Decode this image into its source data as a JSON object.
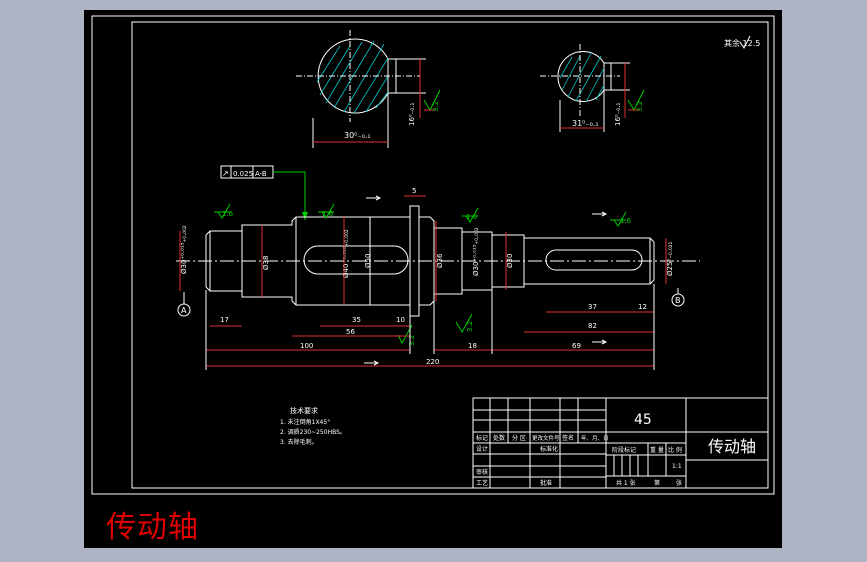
{
  "colors": {
    "background": "#aeb4c4",
    "sheet": "#000000",
    "lines": "#ffffff",
    "dimension": "#e03030",
    "leader": "#00cc00",
    "hatch": "#00c8c8",
    "title_red": "#e00000"
  },
  "page_title": "传动轴",
  "roughness_note": "其余 12.5",
  "sections": {
    "left": {
      "width_dim": "30⁰₋₀.₁",
      "depth_dim": "16⁰₋₀.₁",
      "finish": "3.2"
    },
    "right": {
      "width_dim": "31⁰₋₀.₁",
      "depth_dim": "16⁰₋₀.₁",
      "finish": "3.2"
    }
  },
  "tolerance_frame": {
    "symbol": "↗",
    "value": "0.025",
    "datum": "A-B"
  },
  "surface_finish": [
    "1.6",
    "1.6",
    "1.6",
    "1.6"
  ],
  "side_finish": [
    "3.2",
    "3.2"
  ],
  "datums": [
    "A",
    "B"
  ],
  "diameters": [
    "Ø30⁺⁰·⁰¹⁵₊₀.₀₀₂",
    "Ø38",
    "Ø40⁺⁰·⁰¹⁸₊₀.₀₀₂",
    "Ø50",
    "Ø36",
    "Ø30⁺⁰·⁰¹⁵₊₀.₀₀₂",
    "Ø30",
    "Ø25⁰₋₀.₀₂₁"
  ],
  "dims": {
    "shoulder": "5",
    "d17": "17",
    "d35": "35",
    "d10": "10",
    "d56": "56",
    "d100": "100",
    "d220": "220",
    "d18": "18",
    "d69": "69",
    "d37": "37",
    "d12": "12",
    "d82": "82"
  },
  "notes": {
    "title": "技术要求",
    "items": [
      "1. 未注倒角1X45°",
      "2. 调质230~250HBS。",
      "3. 去除毛刺。"
    ]
  },
  "title_block": {
    "material": "45",
    "part_name": "传动轴",
    "header_cells": [
      "标记",
      "处数",
      "分 区",
      "更改文件号",
      "签名",
      "年、月、日"
    ],
    "row_labels": [
      "设计",
      "审核",
      "工艺"
    ],
    "standardize": "标准化",
    "approve": "批准",
    "stage_labels": [
      "阶段标记",
      "重 量",
      "比 例"
    ],
    "scale": "1:1",
    "sheet_info": [
      "共 1 张",
      "第",
      "张"
    ]
  }
}
